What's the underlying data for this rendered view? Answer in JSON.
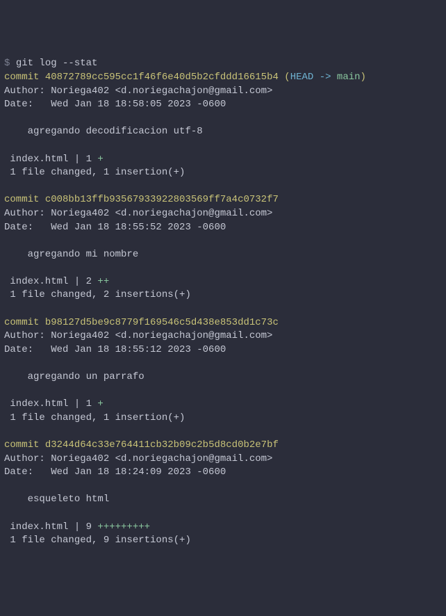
{
  "prompt": "$",
  "command": "git log --stat",
  "commits": [
    {
      "commit_label": "commit",
      "hash": "40872789cc595cc1f46f6e40d5b2cfddd16615b4",
      "ref_open": " (",
      "ref_head": "HEAD -> ",
      "ref_branch": "main",
      "ref_close": ")",
      "author_line": "Author: Noriega402 <d.noriegachajon@gmail.com>",
      "date_line": "Date:   Wed Jan 18 18:58:05 2023 -0600",
      "message": "    agregando decodificacion utf-8",
      "stat_file": " index.html | 1 ",
      "stat_plus": "+",
      "stat_summary": " 1 file changed, 1 insertion(+)"
    },
    {
      "commit_label": "commit",
      "hash": "c008bb13ffb93567933922803569ff7a4c0732f7",
      "author_line": "Author: Noriega402 <d.noriegachajon@gmail.com>",
      "date_line": "Date:   Wed Jan 18 18:55:52 2023 -0600",
      "message": "    agregando mi nombre",
      "stat_file": " index.html | 2 ",
      "stat_plus": "++",
      "stat_summary": " 1 file changed, 2 insertions(+)"
    },
    {
      "commit_label": "commit",
      "hash": "b98127d5be9c8779f169546c5d438e853dd1c73c",
      "author_line": "Author: Noriega402 <d.noriegachajon@gmail.com>",
      "date_line": "Date:   Wed Jan 18 18:55:12 2023 -0600",
      "message": "    agregando un parrafo",
      "stat_file": " index.html | 1 ",
      "stat_plus": "+",
      "stat_summary": " 1 file changed, 1 insertion(+)"
    },
    {
      "commit_label": "commit",
      "hash": "d3244d64c33e764411cb32b09c2b5d8cd0b2e7bf",
      "author_line": "Author: Noriega402 <d.noriegachajon@gmail.com>",
      "date_line": "Date:   Wed Jan 18 18:24:09 2023 -0600",
      "message": "    esqueleto html",
      "stat_file": " index.html | 9 ",
      "stat_plus": "+++++++++",
      "stat_summary": " 1 file changed, 9 insertions(+)"
    }
  ]
}
